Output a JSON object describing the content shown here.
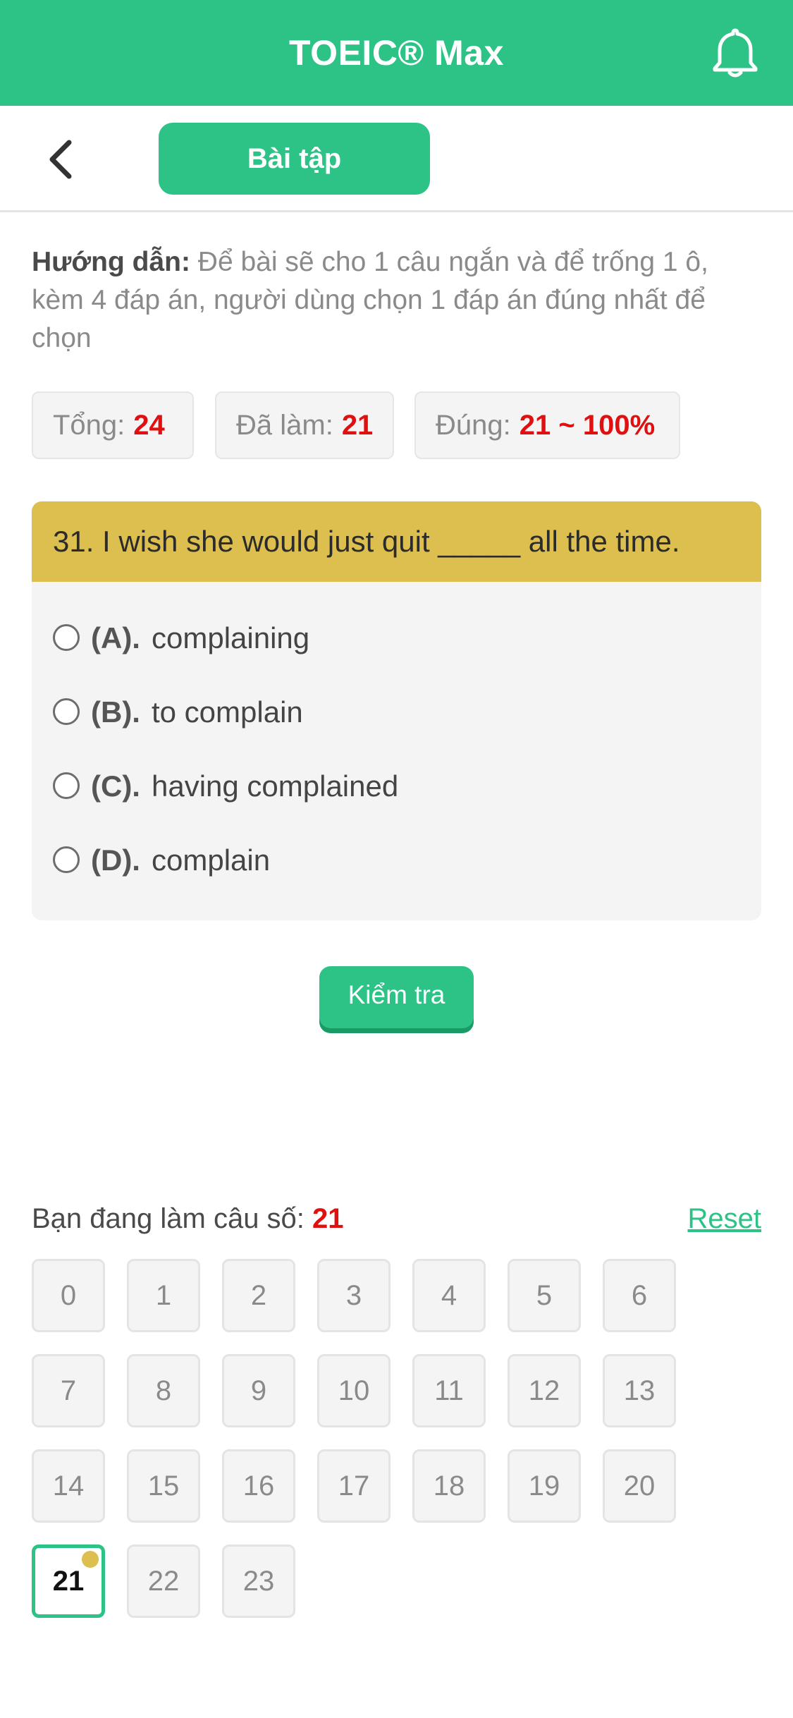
{
  "header": {
    "title": "TOEIC® Max"
  },
  "nav": {
    "tab_label": "Bài tập"
  },
  "instructions": {
    "label": "Hướng dẫn:",
    "text": "Để bài sẽ cho 1 câu ngắn và để trống 1 ô, kèm 4 đáp án, người dùng chọn 1 đáp án đúng nhất để chọn"
  },
  "stats": {
    "total_label": "Tổng:",
    "total_value": "24",
    "done_label": "Đã làm:",
    "done_value": "21",
    "correct_label": "Đúng:",
    "correct_value": "21 ~ 100%"
  },
  "question": {
    "text": "31. I wish she would just quit _____ all the time.",
    "options": [
      {
        "letter": "(A).",
        "text": "complaining"
      },
      {
        "letter": "(B).",
        "text": "to complain"
      },
      {
        "letter": "(C).",
        "text": "having complained"
      },
      {
        "letter": "(D).",
        "text": "complain"
      }
    ]
  },
  "check_button": "Kiểm tra",
  "progress": {
    "label": "Bạn đang làm câu số:",
    "current": "21",
    "reset_label": "Reset",
    "cells": [
      "0",
      "1",
      "2",
      "3",
      "4",
      "5",
      "6",
      "7",
      "8",
      "9",
      "10",
      "11",
      "12",
      "13",
      "14",
      "15",
      "16",
      "17",
      "18",
      "19",
      "20",
      "21",
      "22",
      "23"
    ]
  },
  "colors": {
    "brand": "#2dc286",
    "question_header": "#dcbf4f",
    "highlight_red": "#e01010",
    "card_bg": "#f4f4f4"
  },
  "icons": {
    "bell": "bell-icon",
    "back": "chevron-left-icon"
  }
}
